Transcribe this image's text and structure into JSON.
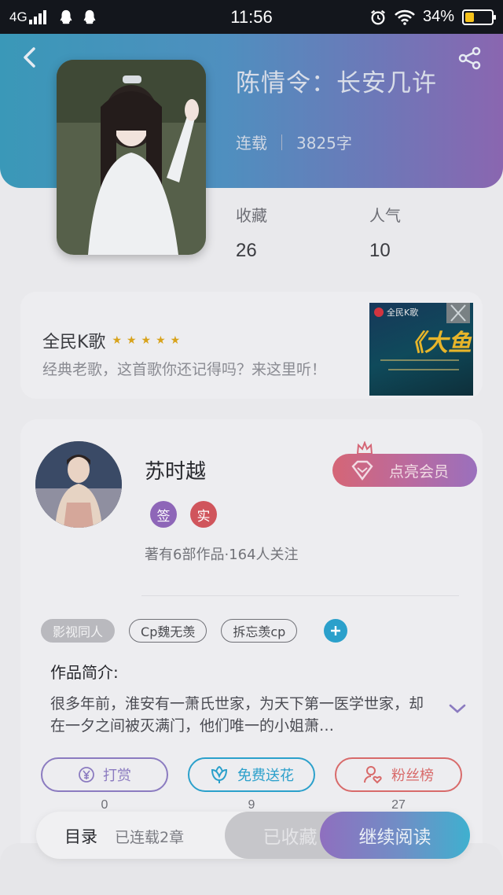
{
  "status_bar": {
    "network": "4G",
    "time": "11:56",
    "battery_percent": "34%",
    "battery_level": 0.34
  },
  "header": {
    "title": "陈情令：长安几许",
    "status": "连载",
    "word_count": "3825字"
  },
  "stats": {
    "favorites_label": "收藏",
    "favorites_value": "26",
    "popularity_label": "人气",
    "popularity_value": "10"
  },
  "ad": {
    "name": "全民K歌",
    "stars": "★★★★★",
    "description": "经典老歌，这首歌你还记得吗？来这里听！",
    "thumb_brand": "全民K歌",
    "thumb_text": "《大鱼"
  },
  "author": {
    "name": "苏时越",
    "badge_signed": "签",
    "badge_verified": "实",
    "works_info": "著有6部作品·164人关注",
    "vip_button": "点亮会员"
  },
  "tags": [
    "影视同人",
    "Cp魏无羡",
    "拆忘羡cp"
  ],
  "intro": {
    "title": "作品简介:",
    "text": "很多年前，淮安有一萧氏世家，为天下第一医学世家，却在一夕之间被灭满门，他们唯一的小姐萧…"
  },
  "actions": [
    {
      "label": "打赏",
      "count": "0",
      "color": "#8b7bc0"
    },
    {
      "label": "免费送花",
      "count": "9",
      "color": "#2ba0cb"
    },
    {
      "label": "粉丝榜",
      "count": "27",
      "color": "#d86a6a"
    }
  ],
  "bottom_bar": {
    "toc": "目录",
    "serial": "已连载2章",
    "collected": "已收藏",
    "continue": "继续阅读"
  }
}
